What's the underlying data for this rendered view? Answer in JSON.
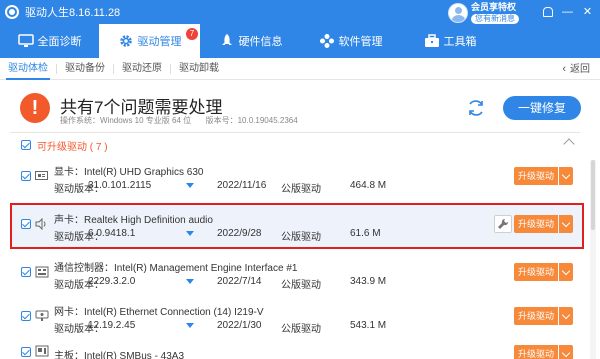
{
  "window": {
    "title": "驱动人生8.16.11.28",
    "controls": [
      "bell-icon",
      "minimize-icon",
      "close-icon"
    ]
  },
  "user": {
    "vip_label": "会员享特权",
    "message": "您有新消息"
  },
  "main_nav": [
    {
      "label": "全面诊断",
      "icon": "monitor-icon",
      "active": false
    },
    {
      "label": "驱动管理",
      "icon": "gear-icon",
      "active": true,
      "badge": "7"
    },
    {
      "label": "硬件信息",
      "icon": "rocket-icon",
      "active": false
    },
    {
      "label": "软件管理",
      "icon": "apps-icon",
      "active": false
    },
    {
      "label": "工具箱",
      "icon": "toolbox-icon",
      "active": false
    }
  ],
  "sub_tabs": [
    {
      "label": "驱动体检",
      "active": true
    },
    {
      "label": "驱动备份",
      "active": false
    },
    {
      "label": "驱动还原",
      "active": false
    },
    {
      "label": "驱动卸载",
      "active": false
    }
  ],
  "back_label": "返回",
  "summary": {
    "title": "共有7个问题需要处理",
    "os_prefix": "操作系统：",
    "os_value": "Windows 10 专业版 64 位",
    "version_prefix": "版本号：",
    "version_value": "10.0.19045.2364",
    "fix_button": "一键修复"
  },
  "group": {
    "label": "可升级驱动 ( 7 )"
  },
  "drivers": [
    {
      "type": "显卡：",
      "name": "Intel(R) UHD Graphics 630",
      "ver_label": "驱动版本：",
      "version": "31.0.101.2115",
      "date": "2022/11/16",
      "ver_type": "公版驱动",
      "size": "464.8 M",
      "action": "升级驱动",
      "icon": "display-card-icon",
      "highlighted": false
    },
    {
      "type": "声卡：",
      "name": "Realtek High Definition audio",
      "ver_label": "驱动版本：",
      "version": "6.0.9418.1",
      "date": "2022/9/28",
      "ver_type": "公版驱动",
      "size": "61.6 M",
      "action": "升级驱动",
      "icon": "speaker-icon",
      "highlighted": true
    },
    {
      "type": "通信控制器：",
      "name": "Intel(R) Management Engine Interface #1",
      "ver_label": "驱动版本：",
      "version": "2229.3.2.0",
      "date": "2022/7/14",
      "ver_type": "公版驱动",
      "size": "343.9 M",
      "action": "升级驱动",
      "icon": "controller-icon",
      "highlighted": false
    },
    {
      "type": "网卡：",
      "name": "Intel(R) Ethernet Connection (14) I219-V",
      "ver_label": "驱动版本：",
      "version": "12.19.2.45",
      "date": "2022/1/30",
      "ver_type": "公版驱动",
      "size": "543.1 M",
      "action": "升级驱动",
      "icon": "network-card-icon",
      "highlighted": false
    },
    {
      "type": "主板：",
      "name": "Intel(R) SMBus - 43A3",
      "ver_label": "",
      "version": "",
      "date": "",
      "ver_type": "",
      "size": "",
      "action": "升级驱动",
      "icon": "motherboard-icon",
      "highlighted": false
    }
  ],
  "colors": {
    "brand": "#2f86e6",
    "warning": "#f25a2c",
    "upgrade": "#f7893b",
    "highlight_border": "#e0201d"
  }
}
